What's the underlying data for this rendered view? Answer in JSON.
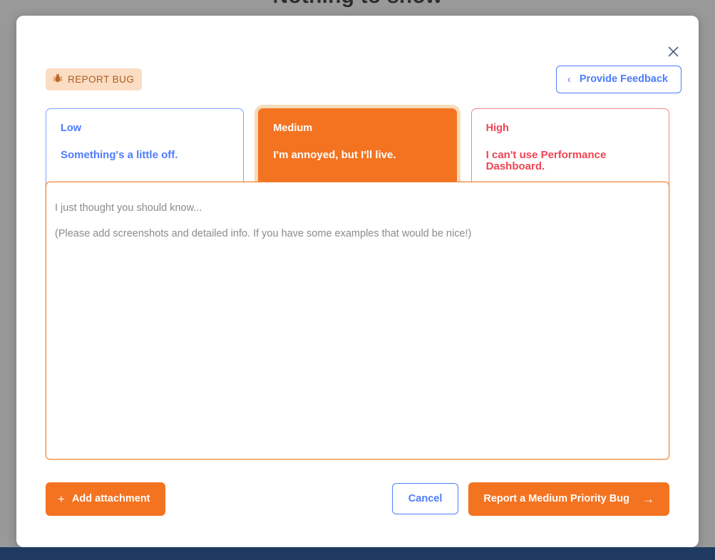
{
  "background": {
    "obscured_page_title": "Nothing to show",
    "overlay_color": "#999999",
    "bottom_bar_color": "#1e3a60"
  },
  "modal": {
    "close_icon": "close-icon",
    "header": {
      "chip": {
        "icon": "bug-icon",
        "label": "REPORT BUG",
        "background": "#fbddc4",
        "text_color": "#a85c1e"
      },
      "feedback_button": {
        "icon": "chevron-left-icon",
        "label": "Provide Feedback",
        "color": "#4d7cfe"
      }
    },
    "severity": {
      "selected": "Medium",
      "options": [
        {
          "key": "low",
          "title": "Low",
          "description": "Something's a little off.",
          "color": "#4d7cfe",
          "selected": false
        },
        {
          "key": "medium",
          "title": "Medium",
          "description": "I'm annoyed, but I'll live.",
          "color": "#f47321",
          "selected": true
        },
        {
          "key": "high",
          "title": "High",
          "description": "I can't use Performance Dashboard.",
          "color": "#ef4452",
          "selected": false
        }
      ]
    },
    "description_field": {
      "value": "",
      "placeholder_line1": "I just thought you should know...",
      "placeholder_line2": "(Please add screenshots and detailed info. If you have some examples that would be nice!)",
      "border_color": "#f08c3c"
    },
    "footer": {
      "add_attachment": {
        "icon": "plus-icon",
        "label": "Add attachment",
        "background": "#f47321"
      },
      "cancel": {
        "label": "Cancel",
        "color": "#4d7cfe"
      },
      "submit": {
        "label": "Report a Medium Priority Bug",
        "icon": "arrow-right-icon",
        "background": "#f47321"
      }
    }
  }
}
